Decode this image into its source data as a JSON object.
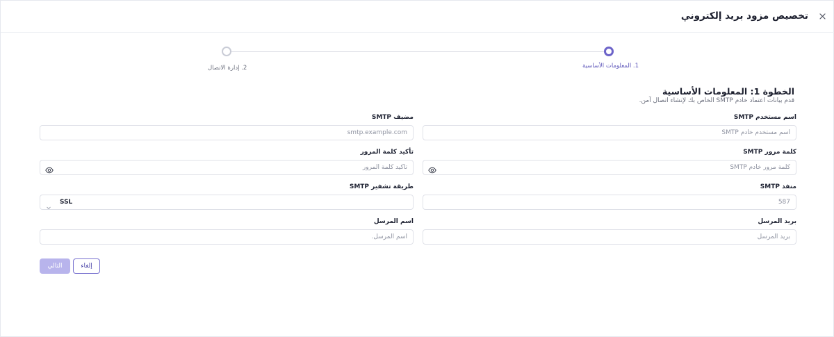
{
  "header": {
    "title": "تخصيص مزود بريد إلكتروني",
    "close_icon": "close-icon"
  },
  "stepper": {
    "steps": [
      {
        "label": "1. المعلومات الأساسية",
        "state": "active"
      },
      {
        "label": "2. إدارة الاتصال",
        "state": "inactive"
      }
    ],
    "active_color": "#6c63c9"
  },
  "section": {
    "title": "الخطوة 1: المعلومات الأساسية",
    "description": "قدم بيانات اعتماد خادم SMTP الخاص بك لإنشاء اتصال آمن."
  },
  "form": {
    "smtp_username": {
      "label": "اسم مستخدم SMTP",
      "value": "",
      "placeholder": "اسم مستخدم خادم SMTP"
    },
    "smtp_host": {
      "label": "مضيف SMTP",
      "value": "",
      "placeholder": "smtp.example.com"
    },
    "smtp_password": {
      "label": "كلمة مرور SMTP",
      "value": "",
      "placeholder": "كلمة مرور خادم SMTP",
      "icon": "eye-icon"
    },
    "confirm_password": {
      "label": "تأكيد كلمة المرور",
      "value": "",
      "placeholder": "تأكيد كلمة المرور",
      "icon": "eye-icon"
    },
    "smtp_port": {
      "label": "منفذ SMTP",
      "value": "",
      "placeholder": "587"
    },
    "smtp_encryption": {
      "label": "طريقة تشفير SMTP",
      "selected": "SSL",
      "icon": "chevron-down-icon"
    },
    "sender_email": {
      "label": "بريد المرسل",
      "value": "",
      "placeholder": "بريد المرسل"
    },
    "sender_name": {
      "label": "اسم المرسل",
      "value": "",
      "placeholder": "اسم المرسل."
    }
  },
  "actions": {
    "cancel_label": "إلغاء",
    "next_label": "التالي",
    "next_color": "#b8b4ec"
  }
}
